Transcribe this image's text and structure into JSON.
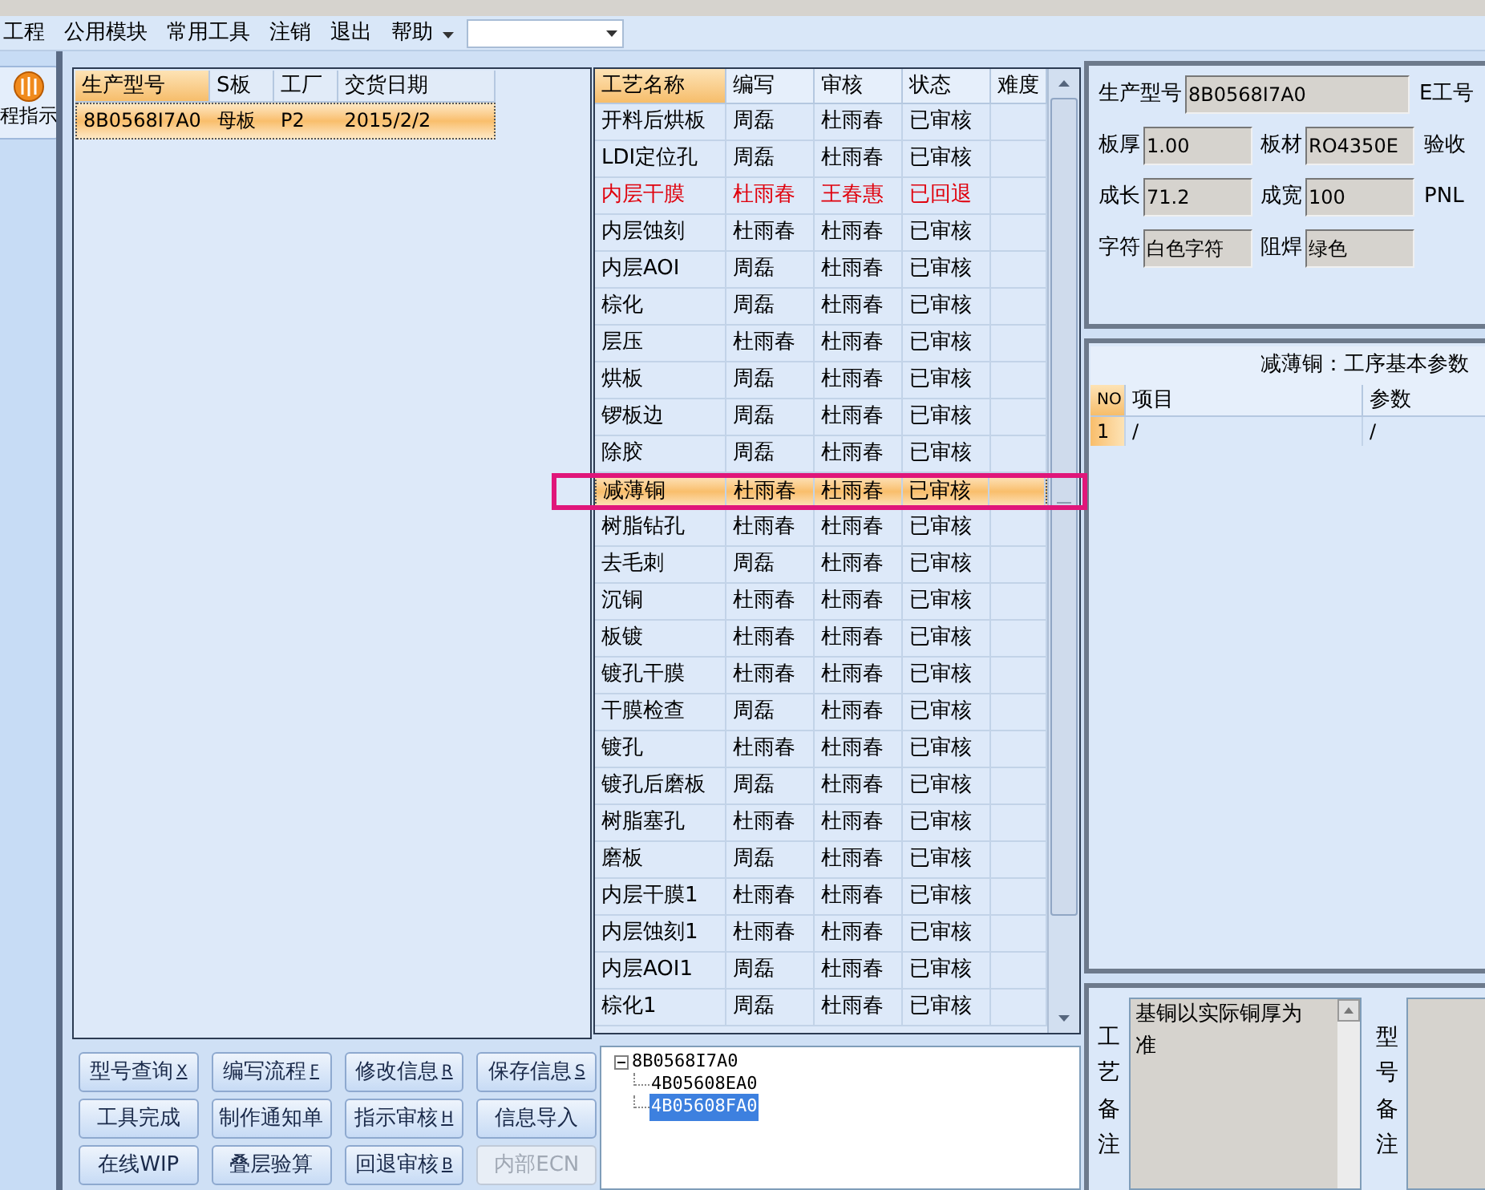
{
  "menu": [
    {
      "label": "工程"
    },
    {
      "label": "公用模块"
    },
    {
      "label": "常用工具"
    },
    {
      "label": "注销"
    },
    {
      "label": "退出"
    },
    {
      "label": "帮助"
    }
  ],
  "side_button": {
    "label": "程指示"
  },
  "orders": {
    "columns": [
      "生产型号",
      "S板",
      "工厂",
      "交货日期"
    ],
    "rows": [
      {
        "cells": [
          "8B0568I7A0",
          "母板",
          "P2",
          "2015/2/2"
        ],
        "selected": true
      }
    ]
  },
  "process": {
    "columns": [
      "工艺名称",
      "编写",
      "审核",
      "状态",
      "难度"
    ],
    "rows": [
      {
        "cells": [
          "开料后烘板",
          "周磊",
          "杜雨春",
          "已审核"
        ],
        "returned": false,
        "selected": false
      },
      {
        "cells": [
          "LDI定位孔",
          "周磊",
          "杜雨春",
          "已审核"
        ],
        "returned": false,
        "selected": false
      },
      {
        "cells": [
          "内层干膜",
          "杜雨春",
          "王春惠",
          "已回退"
        ],
        "returned": true,
        "selected": false
      },
      {
        "cells": [
          "内层蚀刻",
          "杜雨春",
          "杜雨春",
          "已审核"
        ],
        "returned": false,
        "selected": false
      },
      {
        "cells": [
          "内层AOI",
          "周磊",
          "杜雨春",
          "已审核"
        ],
        "returned": false,
        "selected": false
      },
      {
        "cells": [
          "棕化",
          "周磊",
          "杜雨春",
          "已审核"
        ],
        "returned": false,
        "selected": false
      },
      {
        "cells": [
          "层压",
          "杜雨春",
          "杜雨春",
          "已审核"
        ],
        "returned": false,
        "selected": false
      },
      {
        "cells": [
          "烘板",
          "周磊",
          "杜雨春",
          "已审核"
        ],
        "returned": false,
        "selected": false
      },
      {
        "cells": [
          "锣板边",
          "周磊",
          "杜雨春",
          "已审核"
        ],
        "returned": false,
        "selected": false
      },
      {
        "cells": [
          "除胶",
          "周磊",
          "杜雨春",
          "已审核"
        ],
        "returned": false,
        "selected": false
      },
      {
        "cells": [
          "减薄铜",
          "杜雨春",
          "杜雨春",
          "已审核"
        ],
        "returned": false,
        "selected": true
      },
      {
        "cells": [
          "树脂钻孔",
          "杜雨春",
          "杜雨春",
          "已审核"
        ],
        "returned": false,
        "selected": false
      },
      {
        "cells": [
          "去毛刺",
          "周磊",
          "杜雨春",
          "已审核"
        ],
        "returned": false,
        "selected": false
      },
      {
        "cells": [
          "沉铜",
          "杜雨春",
          "杜雨春",
          "已审核"
        ],
        "returned": false,
        "selected": false
      },
      {
        "cells": [
          "板镀",
          "杜雨春",
          "杜雨春",
          "已审核"
        ],
        "returned": false,
        "selected": false
      },
      {
        "cells": [
          "镀孔干膜",
          "杜雨春",
          "杜雨春",
          "已审核"
        ],
        "returned": false,
        "selected": false
      },
      {
        "cells": [
          "干膜检查",
          "周磊",
          "杜雨春",
          "已审核"
        ],
        "returned": false,
        "selected": false
      },
      {
        "cells": [
          "镀孔",
          "杜雨春",
          "杜雨春",
          "已审核"
        ],
        "returned": false,
        "selected": false
      },
      {
        "cells": [
          "镀孔后磨板",
          "周磊",
          "杜雨春",
          "已审核"
        ],
        "returned": false,
        "selected": false
      },
      {
        "cells": [
          "树脂塞孔",
          "杜雨春",
          "杜雨春",
          "已审核"
        ],
        "returned": false,
        "selected": false
      },
      {
        "cells": [
          "磨板",
          "周磊",
          "杜雨春",
          "已审核"
        ],
        "returned": false,
        "selected": false
      },
      {
        "cells": [
          "内层干膜1",
          "杜雨春",
          "杜雨春",
          "已审核"
        ],
        "returned": false,
        "selected": false
      },
      {
        "cells": [
          "内层蚀刻1",
          "杜雨春",
          "杜雨春",
          "已审核"
        ],
        "returned": false,
        "selected": false
      },
      {
        "cells": [
          "内层AOI1",
          "周磊",
          "杜雨春",
          "已审核"
        ],
        "returned": false,
        "selected": false
      },
      {
        "cells": [
          "棕化1",
          "周磊",
          "杜雨春",
          "已审核"
        ],
        "returned": false,
        "selected": false
      }
    ]
  },
  "buttons": [
    {
      "label": "型号查询",
      "hotkey": "X",
      "disabled": false
    },
    {
      "label": "编写流程",
      "hotkey": "F",
      "disabled": false
    },
    {
      "label": "修改信息",
      "hotkey": "R",
      "disabled": false
    },
    {
      "label": "保存信息",
      "hotkey": "S",
      "disabled": false
    },
    {
      "label": "工具完成",
      "disabled": false
    },
    {
      "label": "制作通知单",
      "disabled": false
    },
    {
      "label": "指示审核",
      "hotkey": "H",
      "disabled": false
    },
    {
      "label": "信息导入",
      "disabled": false
    },
    {
      "label": "在线WIP",
      "disabled": false
    },
    {
      "label": "叠层验算",
      "disabled": false
    },
    {
      "label": "回退审核",
      "hotkey": "B",
      "disabled": false
    },
    {
      "label": "内部ECN",
      "disabled": true
    }
  ],
  "tree": {
    "label": "8B0568I7A0",
    "expanded": true,
    "selected": false,
    "children": [
      {
        "label": "4B05608EA0",
        "selected": false
      },
      {
        "label": "4B05608FA0",
        "selected": true
      }
    ]
  },
  "info": {
    "model_field": {
      "label": "生产型号",
      "value": "8B0568I7A0"
    },
    "e_number_label": "E工号",
    "fields": [
      [
        {
          "label": "板厚",
          "value": "1.00"
        },
        {
          "label": "板材",
          "value": "RO4350E"
        }
      ],
      [
        {
          "label": "成长",
          "value": "71.2"
        },
        {
          "label": "成宽",
          "value": "100"
        }
      ],
      [
        {
          "label": "字符",
          "value": "白色字符"
        },
        {
          "label": "阻焊",
          "value": "绿色"
        }
      ]
    ],
    "side_labels": [
      "验收",
      "PNL"
    ]
  },
  "params": {
    "title": "减薄铜：工序基本参数",
    "columns": [
      "NO",
      "项目",
      "参数"
    ],
    "rows": [
      [
        "1",
        "/",
        "/"
      ]
    ]
  },
  "remarks": {
    "process_label": "工艺备注",
    "process_text": "基铜以实际铜厚为准",
    "model_label": "型号备注"
  }
}
